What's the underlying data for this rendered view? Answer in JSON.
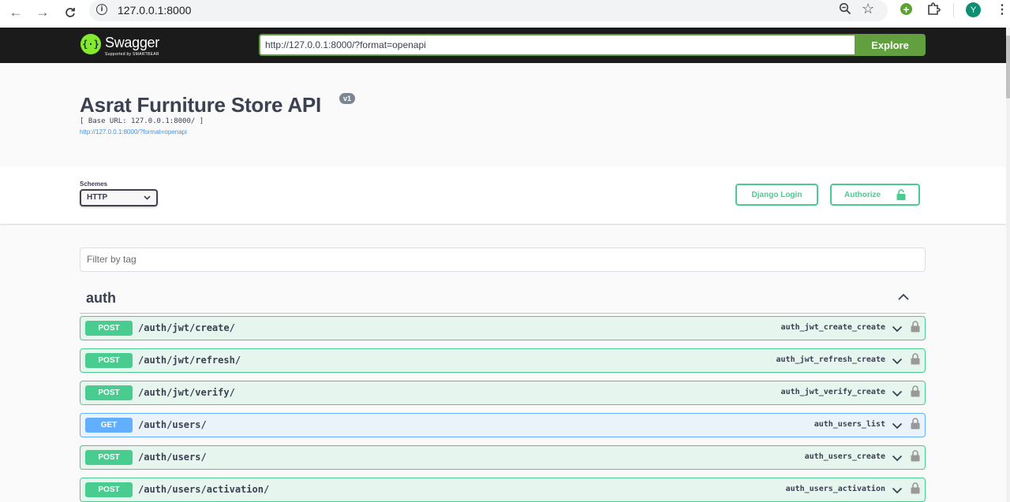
{
  "browser": {
    "url": "127.0.0.1:8000",
    "avatar_letter": "Y",
    "icons": [
      "back-icon",
      "forward-icon",
      "reload-icon",
      "info-icon",
      "zoom-icon",
      "star-icon",
      "extension-icon",
      "puzzle-icon",
      "menu-icon"
    ]
  },
  "topbar": {
    "logo_text": "Swagger",
    "logo_sub": "Supported by SMARTBEAR",
    "spec_url": "http://127.0.0.1:8000/?format=openapi",
    "explore_label": "Explore"
  },
  "info": {
    "title": "Asrat Furniture Store API",
    "version": "v1",
    "base_url": "[ Base URL: 127.0.0.1:8000/ ]",
    "spec_link": "http://127.0.0.1:8000/?format=openapi"
  },
  "schemes": {
    "label": "Schemes",
    "selected": "HTTP",
    "django_login_label": "Django Login",
    "authorize_label": "Authorize"
  },
  "filter": {
    "placeholder": "Filter by tag"
  },
  "tag": {
    "name": "auth",
    "operations": [
      {
        "method": "POST",
        "path": "/auth/jwt/create/",
        "operation_id": "auth_jwt_create_create"
      },
      {
        "method": "POST",
        "path": "/auth/jwt/refresh/",
        "operation_id": "auth_jwt_refresh_create"
      },
      {
        "method": "POST",
        "path": "/auth/jwt/verify/",
        "operation_id": "auth_jwt_verify_create"
      },
      {
        "method": "GET",
        "path": "/auth/users/",
        "operation_id": "auth_users_list"
      },
      {
        "method": "POST",
        "path": "/auth/users/",
        "operation_id": "auth_users_create"
      },
      {
        "method": "POST",
        "path": "/auth/users/activation/",
        "operation_id": "auth_users_activation"
      }
    ]
  },
  "colors": {
    "post": "#49cc90",
    "get": "#61affe",
    "topbar_bg": "#1b1b1b",
    "explore_green": "#62a03f"
  }
}
